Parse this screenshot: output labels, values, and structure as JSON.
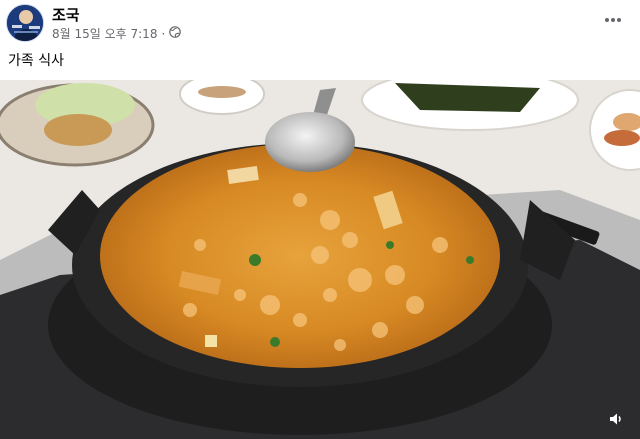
{
  "post": {
    "author": "조국",
    "date": "8월 15일 오후 7:18",
    "separator": "·",
    "privacy_icon": "globe-icon",
    "more_icon": "more-horizontal-icon",
    "caption": "가족 식사"
  },
  "media": {
    "type": "video",
    "description_icon": "food-photo",
    "sound_icon": "speaker-icon"
  },
  "colors": {
    "text_primary": "#050505",
    "text_secondary": "#65676b",
    "avatar_bg": "#1d3a78"
  }
}
